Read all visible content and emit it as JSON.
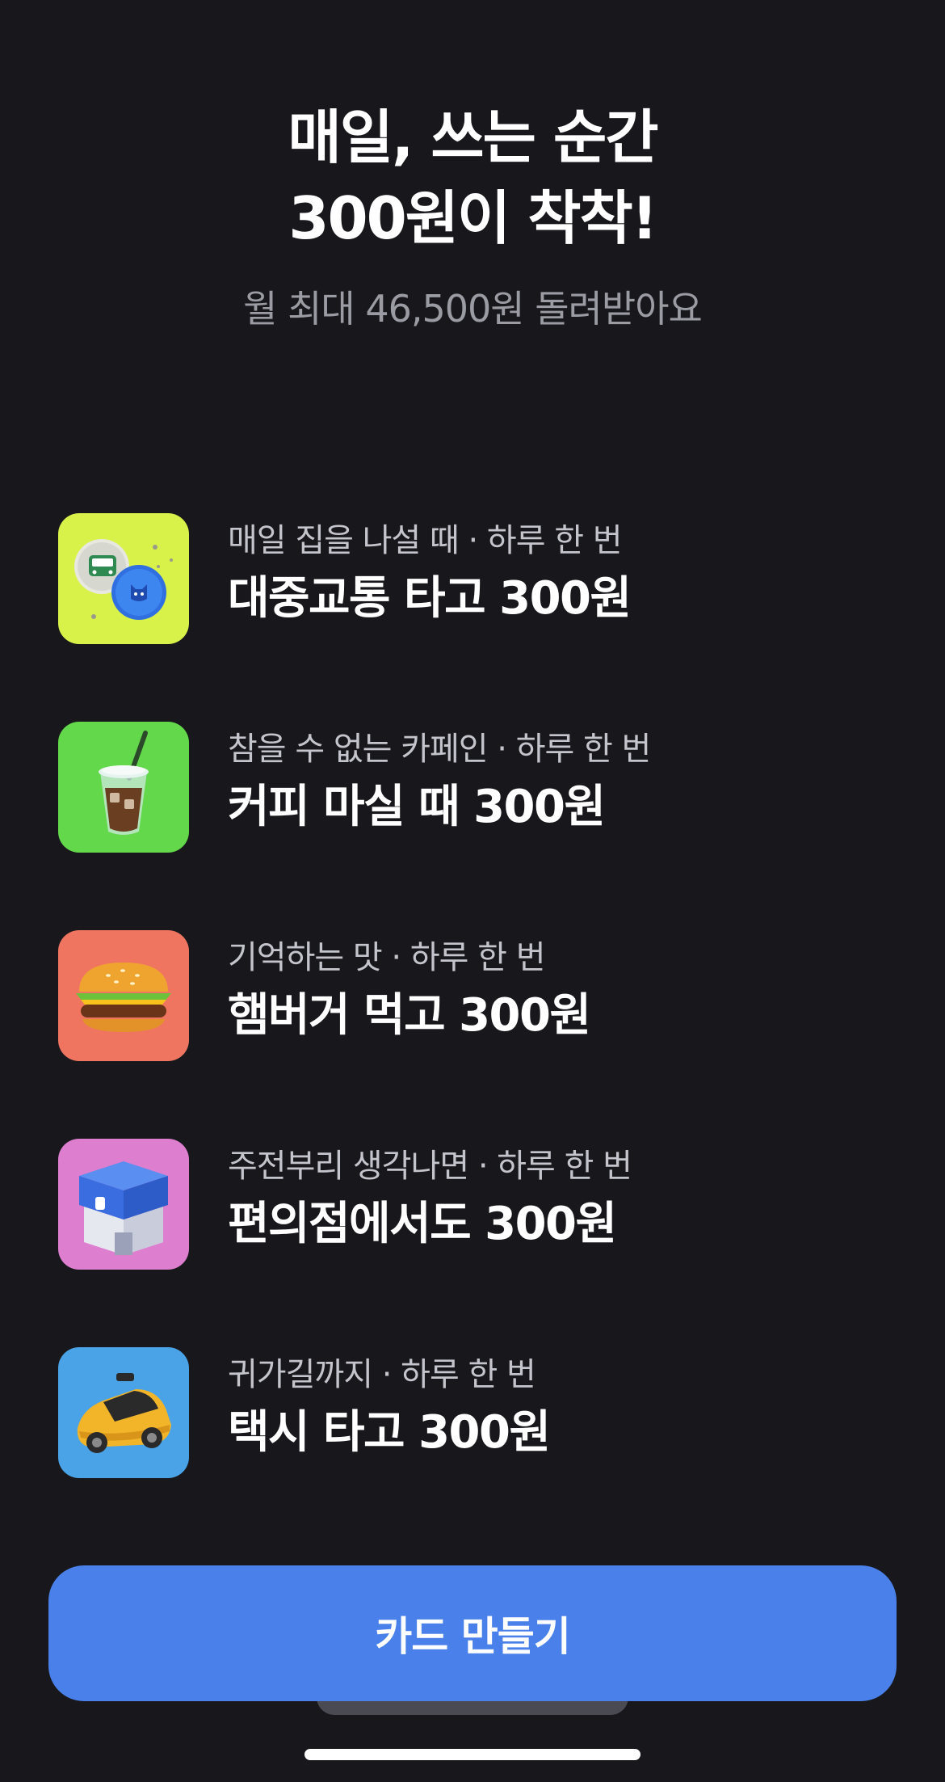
{
  "hero": {
    "title_line1": "매일, 쓰는 순간",
    "title_line2": "300원이 착착!",
    "subtitle": "월 최대 46,500원 돌려받아요"
  },
  "benefits": [
    {
      "caption": "매일 집을 나설 때 · 하루 한 번",
      "title": "대중교통 타고 300원",
      "icon": "transit-card-icon",
      "color": "#d9f24a"
    },
    {
      "caption": "참을 수 없는 카페인 · 하루 한 번",
      "title": "커피 마실 때 300원",
      "icon": "iced-coffee-icon",
      "color": "#62d84a"
    },
    {
      "caption": "기억하는 맛 · 하루 한 번",
      "title": "햄버거 먹고 300원",
      "icon": "hamburger-icon",
      "color": "#ef7560"
    },
    {
      "caption": "주전부리 생각나면 · 하루 한 번",
      "title": "편의점에서도 300원",
      "icon": "convenience-store-icon",
      "color": "#dd7ecf"
    },
    {
      "caption": "귀가길까지 · 하루 한 번",
      "title": "택시 타고 300원",
      "icon": "taxi-icon",
      "color": "#4aa3e6"
    }
  ],
  "cta": {
    "label": "카드 만들기"
  }
}
